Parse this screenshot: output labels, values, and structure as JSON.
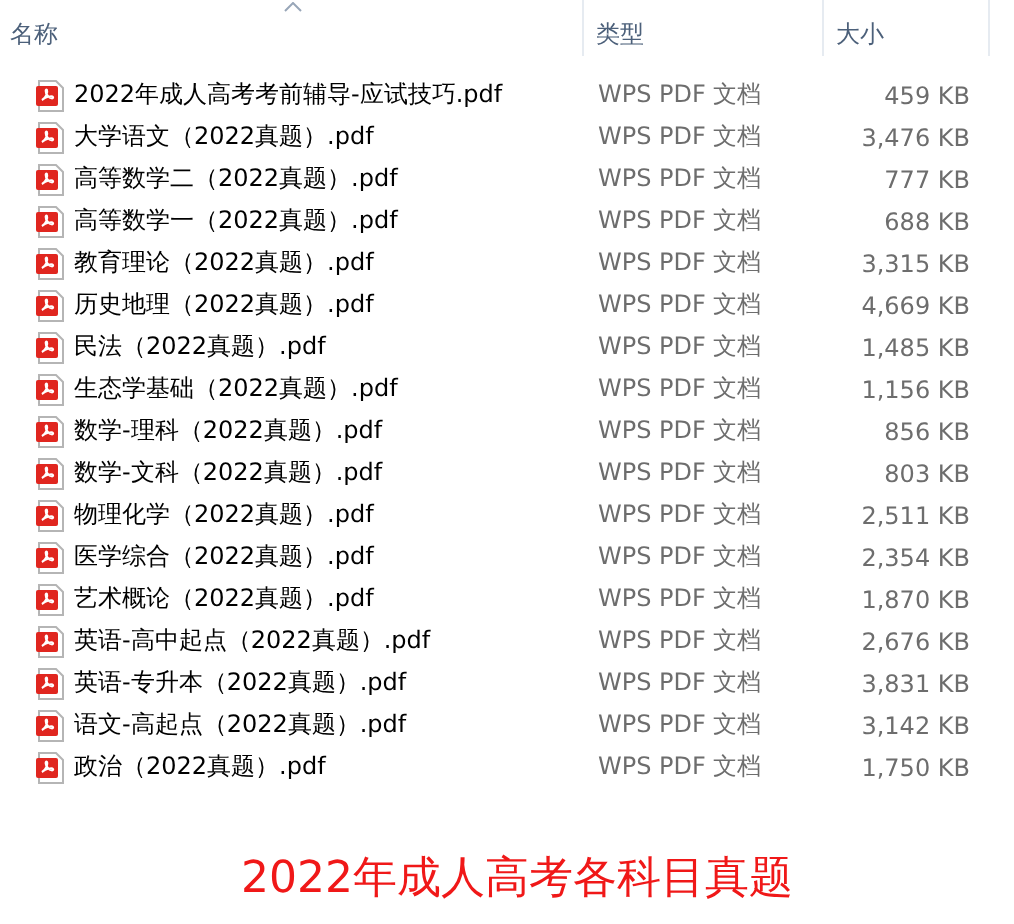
{
  "columns": [
    {
      "label": "名称",
      "sorted": true
    },
    {
      "label": "类型",
      "sorted": false
    },
    {
      "label": "大小",
      "sorted": false
    }
  ],
  "files": [
    {
      "name": "2022年成人高考考前辅导-应试技巧.pdf",
      "type": "WPS PDF 文档",
      "size": "459 KB"
    },
    {
      "name": "大学语文（2022真题）.pdf",
      "type": "WPS PDF 文档",
      "size": "3,476 KB"
    },
    {
      "name": "高等数学二（2022真题）.pdf",
      "type": "WPS PDF 文档",
      "size": "777 KB"
    },
    {
      "name": "高等数学一（2022真题）.pdf",
      "type": "WPS PDF 文档",
      "size": "688 KB"
    },
    {
      "name": "教育理论（2022真题）.pdf",
      "type": "WPS PDF 文档",
      "size": "3,315 KB"
    },
    {
      "name": "历史地理（2022真题）.pdf",
      "type": "WPS PDF 文档",
      "size": "4,669 KB"
    },
    {
      "name": "民法（2022真题）.pdf",
      "type": "WPS PDF 文档",
      "size": "1,485 KB"
    },
    {
      "name": "生态学基础（2022真题）.pdf",
      "type": "WPS PDF 文档",
      "size": "1,156 KB"
    },
    {
      "name": "数学-理科（2022真题）.pdf",
      "type": "WPS PDF 文档",
      "size": "856 KB"
    },
    {
      "name": "数学-文科（2022真题）.pdf",
      "type": "WPS PDF 文档",
      "size": "803 KB"
    },
    {
      "name": "物理化学（2022真题）.pdf",
      "type": "WPS PDF 文档",
      "size": "2,511 KB"
    },
    {
      "name": "医学综合（2022真题）.pdf",
      "type": "WPS PDF 文档",
      "size": "2,354 KB"
    },
    {
      "name": "艺术概论（2022真题）.pdf",
      "type": "WPS PDF 文档",
      "size": "1,870 KB"
    },
    {
      "name": "英语-高中起点（2022真题）.pdf",
      "type": "WPS PDF 文档",
      "size": "2,676 KB"
    },
    {
      "name": "英语-专升本（2022真题）.pdf",
      "type": "WPS PDF 文档",
      "size": "3,831 KB"
    },
    {
      "name": "语文-高起点（2022真题）.pdf",
      "type": "WPS PDF 文档",
      "size": "3,142 KB"
    },
    {
      "name": "政治（2022真题）.pdf",
      "type": "WPS PDF 文档",
      "size": "1,750 KB"
    }
  ],
  "caption": "2022年成人高考各科目真题"
}
